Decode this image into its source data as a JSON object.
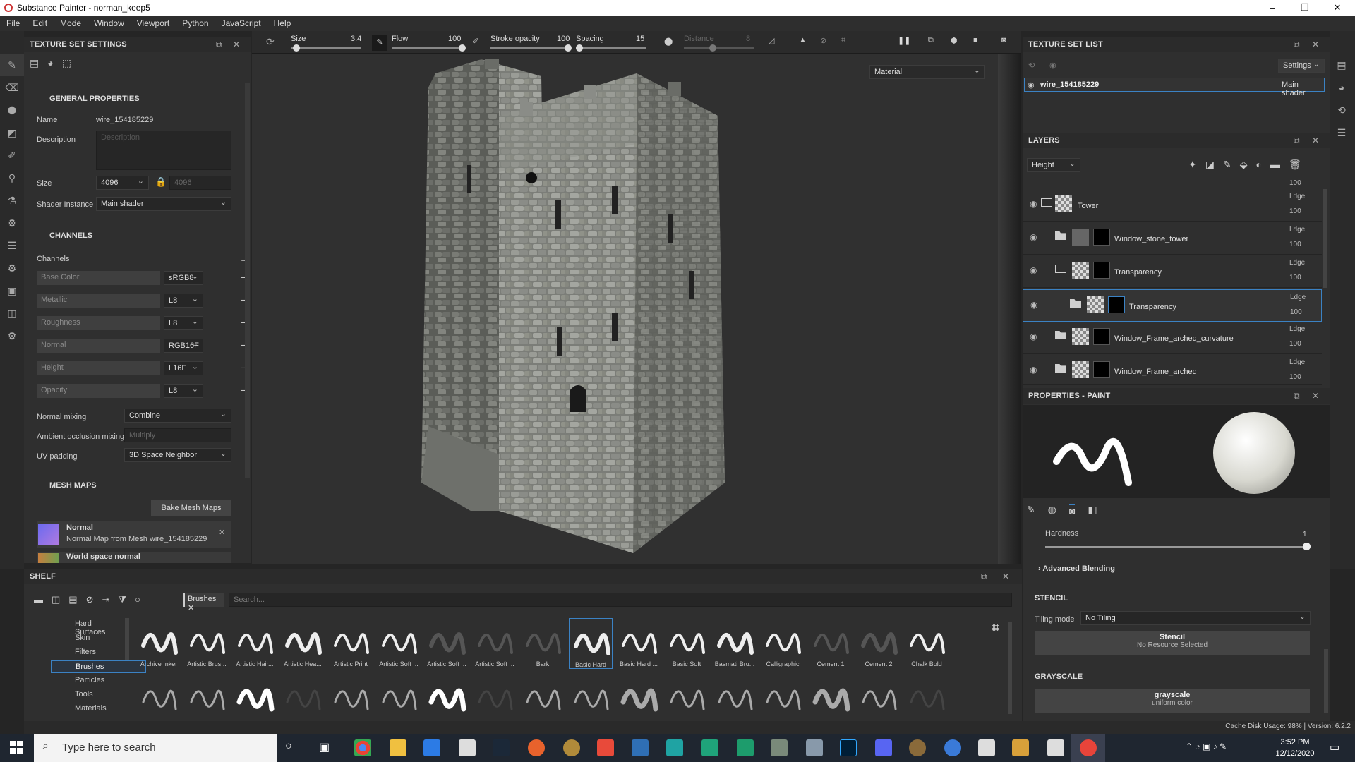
{
  "window": {
    "title": "Substance Painter - norman_keep5",
    "min": "–",
    "max": "❐",
    "close": "✕"
  },
  "menu": [
    "File",
    "Edit",
    "Mode",
    "Window",
    "Viewport",
    "Python",
    "JavaScript",
    "Help"
  ],
  "toolbar": {
    "size_label": "Size",
    "size_value": "3.4",
    "flow_label": "Flow",
    "flow_value": "100",
    "stroke_label": "Stroke opacity",
    "stroke_value": "100",
    "spacing_label": "Spacing",
    "spacing_value": "15",
    "distance_label": "Distance",
    "distance_value": "8",
    "size_level": 0.08,
    "flow_level": 1.0,
    "stroke_level": 1.0,
    "spacing_level": 0.05
  },
  "tss": {
    "title": "TEXTURE SET SETTINGS",
    "general": "GENERAL PROPERTIES",
    "name_label": "Name",
    "name_value": "wire_154185229",
    "desc_label": "Description",
    "desc_placeholder": "Description",
    "size_label": "Size",
    "size_value": "4096",
    "size_locked": "4096",
    "shader_label": "Shader Instance",
    "shader_value": "Main shader",
    "channels_title": "CHANNELS",
    "channels_label": "Channels",
    "channels": [
      {
        "name": "Base Color",
        "fmt": "sRGB8"
      },
      {
        "name": "Metallic",
        "fmt": "L8"
      },
      {
        "name": "Roughness",
        "fmt": "L8"
      },
      {
        "name": "Normal",
        "fmt": "RGB16F"
      },
      {
        "name": "Height",
        "fmt": "L16F"
      },
      {
        "name": "Opacity",
        "fmt": "L8"
      }
    ],
    "normal_mix_label": "Normal mixing",
    "normal_mix_value": "Combine",
    "ao_label": "Ambient occlusion mixing",
    "ao_value": "Multiply",
    "uv_label": "UV padding",
    "uv_value": "3D Space Neighbor",
    "mesh_title": "MESH MAPS",
    "bake_button": "Bake Mesh Maps",
    "map1_title": "Normal",
    "map1_sub": "Normal Map from Mesh wire_154185229",
    "map2_title": "World space normal"
  },
  "viewport": {
    "mode": "Material"
  },
  "tsl": {
    "title": "TEXTURE SET LIST",
    "settings": "Settings",
    "set_name": "wire_154185229",
    "set_shader": "Main shader"
  },
  "layers": {
    "title": "LAYERS",
    "channel": "Height",
    "top_op": "100",
    "items": [
      {
        "name": "Tower",
        "blend": "Ldge",
        "op": "100"
      },
      {
        "name": "Window_stone_tower",
        "blend": "Ldge",
        "op": "100"
      },
      {
        "name": "Transparency",
        "blend": "Ldge",
        "op": "100"
      },
      {
        "name": "Transparency",
        "blend": "Ldge",
        "op": "100"
      },
      {
        "name": "Window_Frame_arched_curvature",
        "blend": "Ldge",
        "op": "100"
      },
      {
        "name": "Window_Frame_arched",
        "blend": "Ldge",
        "op": "100"
      }
    ]
  },
  "props": {
    "title": "PROPERTIES - PAINT",
    "hardness_label": "Hardness",
    "hardness_value": "1",
    "advanced": "Advanced Blending",
    "stencil_title": "STENCIL",
    "tiling_label": "Tiling mode",
    "tiling_value": "No Tiling",
    "stencil_btn": "Stencil",
    "stencil_sub": "No Resource Selected",
    "gray_title": "GRAYSCALE",
    "gray_btn": "grayscale",
    "gray_sub": "uniform color"
  },
  "status": {
    "cache": "Cache Disk Usage:  98% | Version: 6.2.2"
  },
  "shelf": {
    "title": "SHELF",
    "filter_tag": "Brushes",
    "search_placeholder": "Search...",
    "categories": [
      "Hard Surfaces",
      "Skin",
      "Filters",
      "Brushes",
      "Particles",
      "Tools",
      "Materials"
    ],
    "brushes": [
      "Archive Inker",
      "Artistic Brus...",
      "Artistic Hair...",
      "Artistic Hea...",
      "Artistic Print",
      "Artistic Soft ...",
      "Artistic Soft ...",
      "Artistic Soft ...",
      "Bark",
      "Basic Hard",
      "Basic Hard ...",
      "Basic Soft",
      "Basmati Bru...",
      "Calligraphic",
      "Cement 1",
      "Cement 2",
      "Chalk Bold"
    ]
  },
  "taskbar": {
    "search": "Type here to search",
    "time": "3:52 PM",
    "date": "12/12/2020"
  },
  "colors": {
    "accent": "#3b82c4",
    "panel": "#2f2f2f",
    "viewport": "#303030"
  }
}
